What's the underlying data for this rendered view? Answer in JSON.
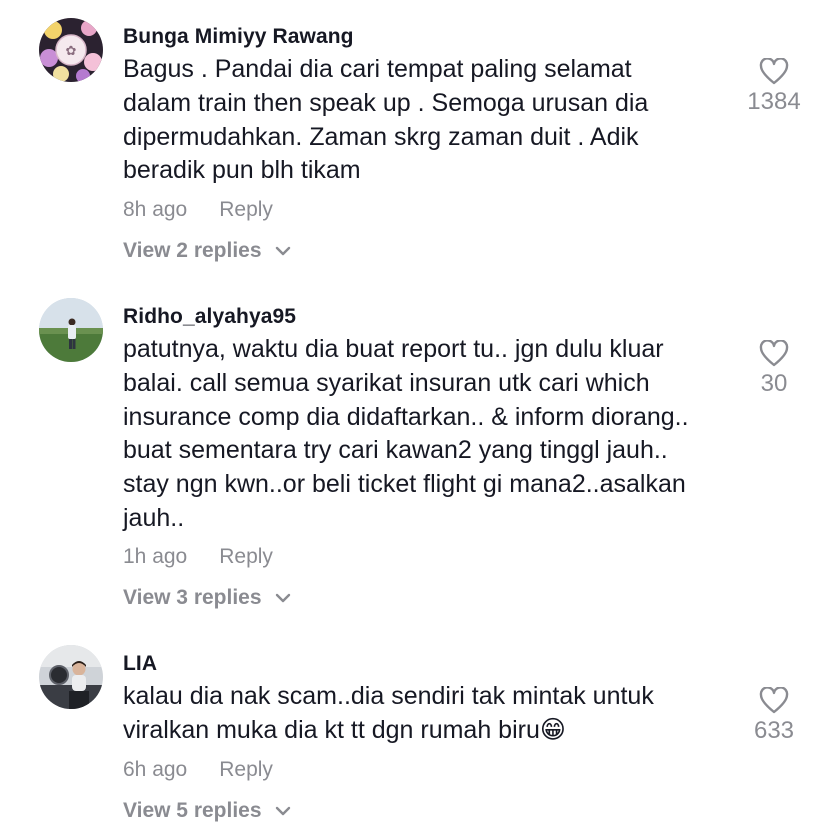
{
  "comments": [
    {
      "username": "Bunga Mimiyy Rawang",
      "text": "Bagus . Pandai dia cari tempat paling selamat\ndalam train then speak up . Semoga urusan dia\ndipermudahkan. Zaman skrg zaman duit . Adik\nberadik pun blh tikam",
      "time": "8h ago",
      "reply_label": "Reply",
      "view_replies": "View 2 replies",
      "likes": "1384"
    },
    {
      "username": "Ridho_alyahya95",
      "text": "patutnya, waktu dia buat report tu.. jgn dulu kluar\nbalai. call semua syarikat insuran utk cari which\ninsurance comp dia didaftarkan.. & inform diorang..\nbuat sementara try cari kawan2 yang tinggl jauh..\nstay ngn kwn..or beli ticket flight gi mana2..asalkan\njauh..",
      "time": "1h ago",
      "reply_label": "Reply",
      "view_replies": "View 3 replies",
      "likes": "30"
    },
    {
      "username": "LIA",
      "text": "kalau dia nak scam..dia sendiri tak mintak untuk\nviralkan muka dia kt tt dgn rumah biru😁",
      "time": "6h ago",
      "reply_label": "Reply",
      "view_replies": "View 5 replies",
      "likes": "633"
    }
  ],
  "icons": {
    "like": "heart-outline-icon",
    "expand": "chevron-down-icon"
  },
  "colors": {
    "text": "#161823",
    "muted": "#8a8b91",
    "background": "#ffffff"
  }
}
